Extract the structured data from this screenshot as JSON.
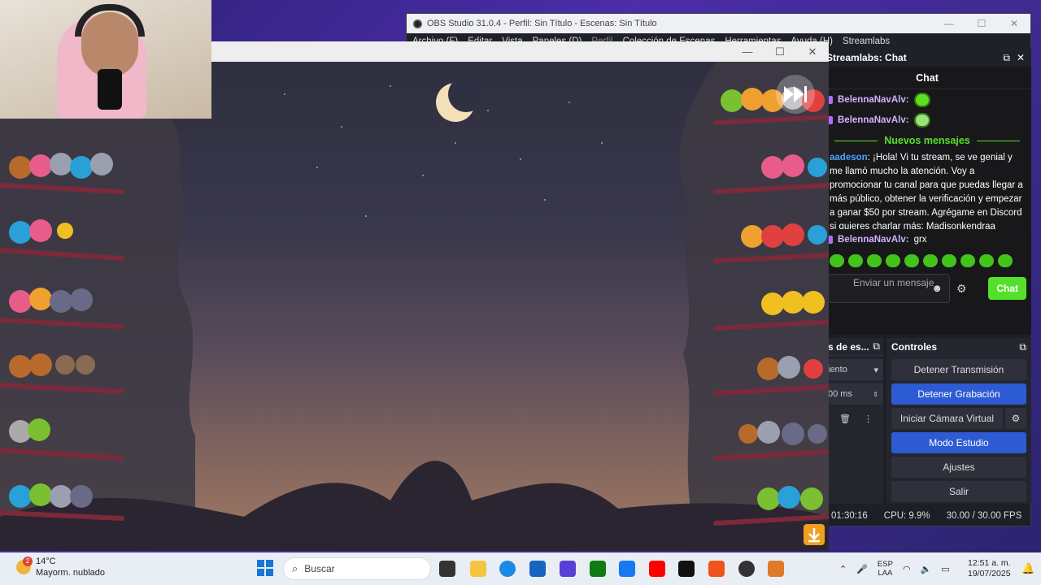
{
  "obs": {
    "title": "OBS Studio 31.0.4 - Perfil: Sin Título - Escenas: Sin Título",
    "menu": [
      "Archivo (F)",
      "Editar",
      "Vista",
      "Paneles (D)",
      "Perfil",
      "Colección de Escenas",
      "Herramientas",
      "Ayuda (H)",
      "Streamlabs"
    ]
  },
  "chat": {
    "panel_title": "Streamlabs: Chat",
    "header": "Chat",
    "messages": [
      {
        "user": "BelennaNavAlv:",
        "emote": "green-face-emote"
      },
      {
        "user": "BelennaNavAlv:",
        "emote": "glasses-face-emote"
      }
    ],
    "new_messages_label": "Nuevos mensajes",
    "long_message": {
      "user": "Madsonkendraadeson",
      "user_visible": "aadeson",
      "text": ": ¡Hola! Vi tu stream, se ve genial y me llamó mucho la atención. Voy a promocionar tu canal para que puedas llegar a más público, obtener la verificación y empezar a ganar $50 por stream. Agrégame en Discord si quieres charlar más: Madisonkendraa"
    },
    "last_message": {
      "user": "BelennaNavAlv:",
      "text": "grx"
    },
    "input_placeholder": "Enviar un mensaje",
    "send_label": "Chat"
  },
  "dock_left": {
    "header": "s de es...",
    "field1": "iento",
    "field2": "00 ms"
  },
  "controls": {
    "header": "Controles",
    "stop_stream": "Detener Transmisión",
    "stop_recording": "Detener Grabación",
    "start_virtual_cam": "Iniciar Cámara Virtual",
    "studio_mode": "Modo Estudio",
    "settings": "Ajustes",
    "exit": "Salir"
  },
  "status": {
    "time": "01:30:16",
    "cpu": "CPU: 9.9%",
    "fps": "30.00 / 30.00 FPS"
  },
  "taskbar": {
    "weather_temp": "14°C",
    "weather_desc": "Mayorm. nublado",
    "weather_badge": "2",
    "search_placeholder": "Buscar",
    "lang_top": "ESP",
    "lang_bottom": "LAA",
    "time": "12:51 a. m.",
    "date": "19/07/2025"
  },
  "colors": {
    "accent_green": "#54e02a",
    "obs_blue": "#2d5bd4",
    "chat_bg": "#18181b"
  }
}
